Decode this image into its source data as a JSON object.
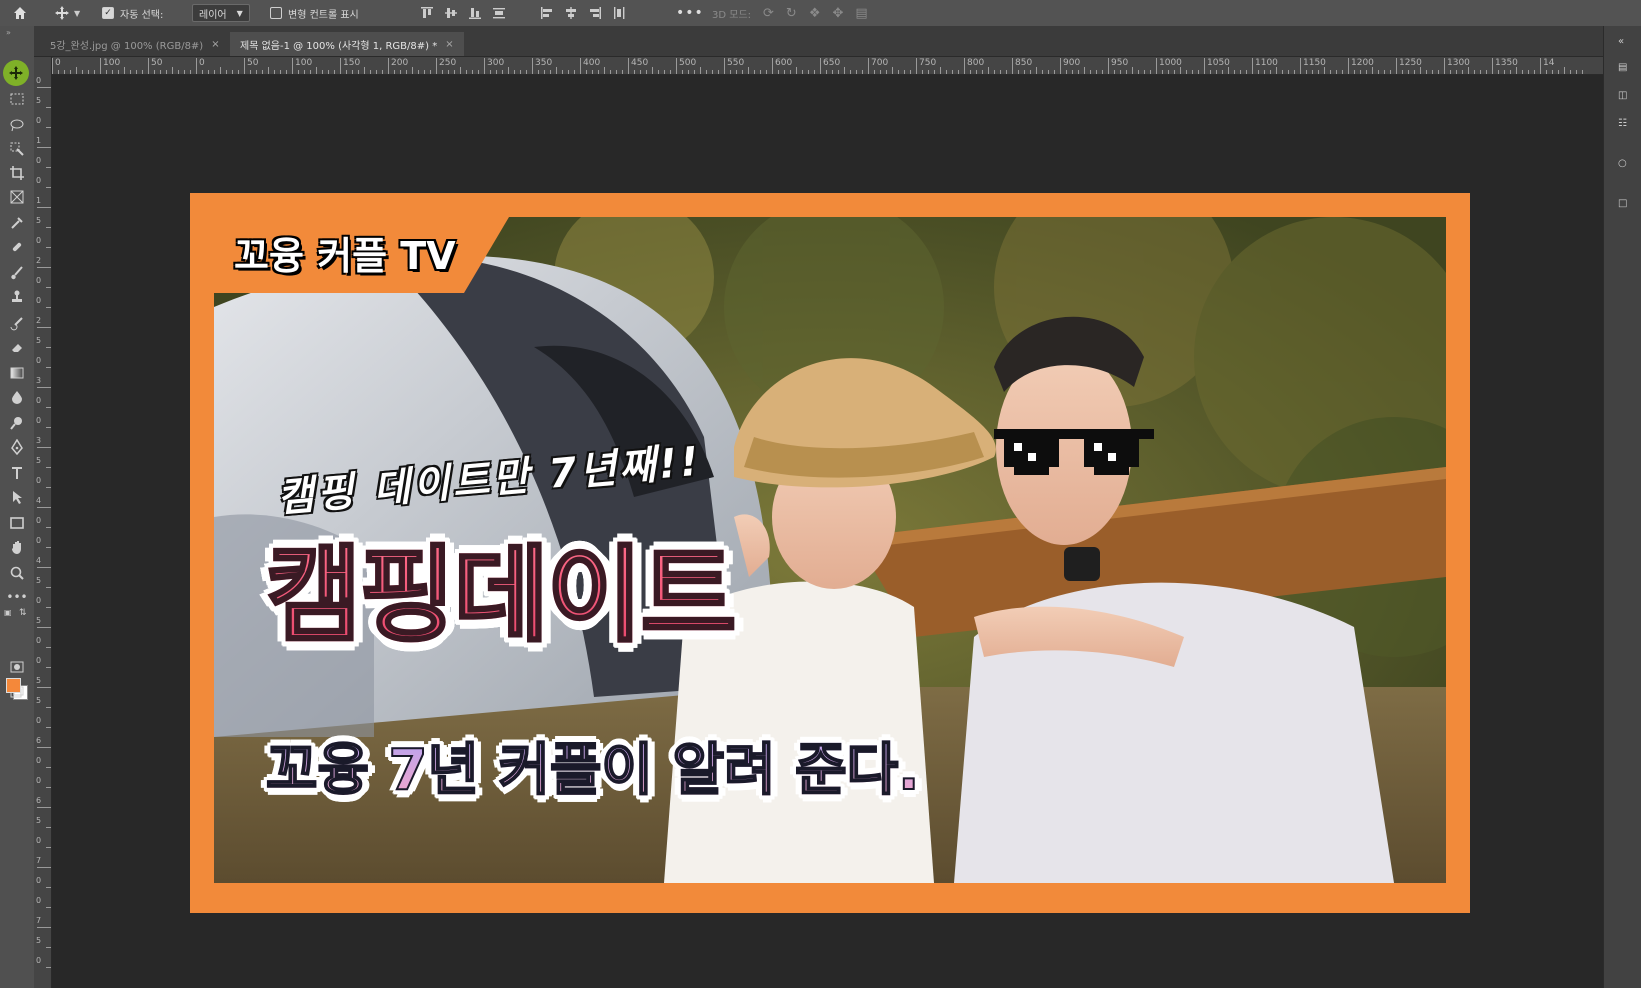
{
  "options_bar": {
    "auto_select_label": "자동 선택:",
    "auto_select_checked": true,
    "target_value": "레이어",
    "transform_controls_label": "변형 컨트롤 표시",
    "mode_3d_label": "3D 모드:"
  },
  "tabs": [
    {
      "label": "5강_완성.jpg @ 100% (RGB/8#)",
      "active": false
    },
    {
      "label": "제목 없음-1 @ 100% (사각형 1, RGB/8#) *",
      "active": true
    }
  ],
  "ruler": {
    "h_labels": [
      "0",
      "100",
      "50",
      "0",
      "50",
      "100",
      "150",
      "200",
      "250",
      "300",
      "350",
      "400",
      "450",
      "500",
      "550",
      "600",
      "650",
      "700",
      "750",
      "800",
      "850",
      "900",
      "950",
      "1000",
      "1050",
      "1100",
      "1150",
      "1200",
      "1250",
      "1300",
      "1350",
      "14"
    ],
    "v_labels": [
      "0",
      "5",
      "0",
      "1",
      "0",
      "0",
      "1",
      "5",
      "0",
      "2",
      "0",
      "0",
      "2",
      "5",
      "0",
      "3",
      "0",
      "0",
      "3",
      "5",
      "0",
      "4",
      "0",
      "0",
      "4",
      "5",
      "0",
      "5",
      "0",
      "0",
      "5",
      "5",
      "0",
      "6",
      "0",
      "0",
      "6",
      "5",
      "0",
      "7",
      "0",
      "0",
      "7",
      "5",
      "0"
    ]
  },
  "colors": {
    "foreground": "#f4883a",
    "background": "#ffffff",
    "artboard_border": "#f28a3a",
    "title_pink": "#ff6d8a",
    "subtitle_lilac": "#b9a3f0"
  },
  "thumbnail": {
    "brand": "꼬융 커플 TV",
    "handwritten": "캠핑 데이트만 7년째!!",
    "title": "캠핑데이트",
    "subtitle": "꼬융 7년 커플이 알려 준다."
  },
  "icons": {
    "home": "home-icon",
    "move": "move-icon",
    "more": "more-icon"
  }
}
